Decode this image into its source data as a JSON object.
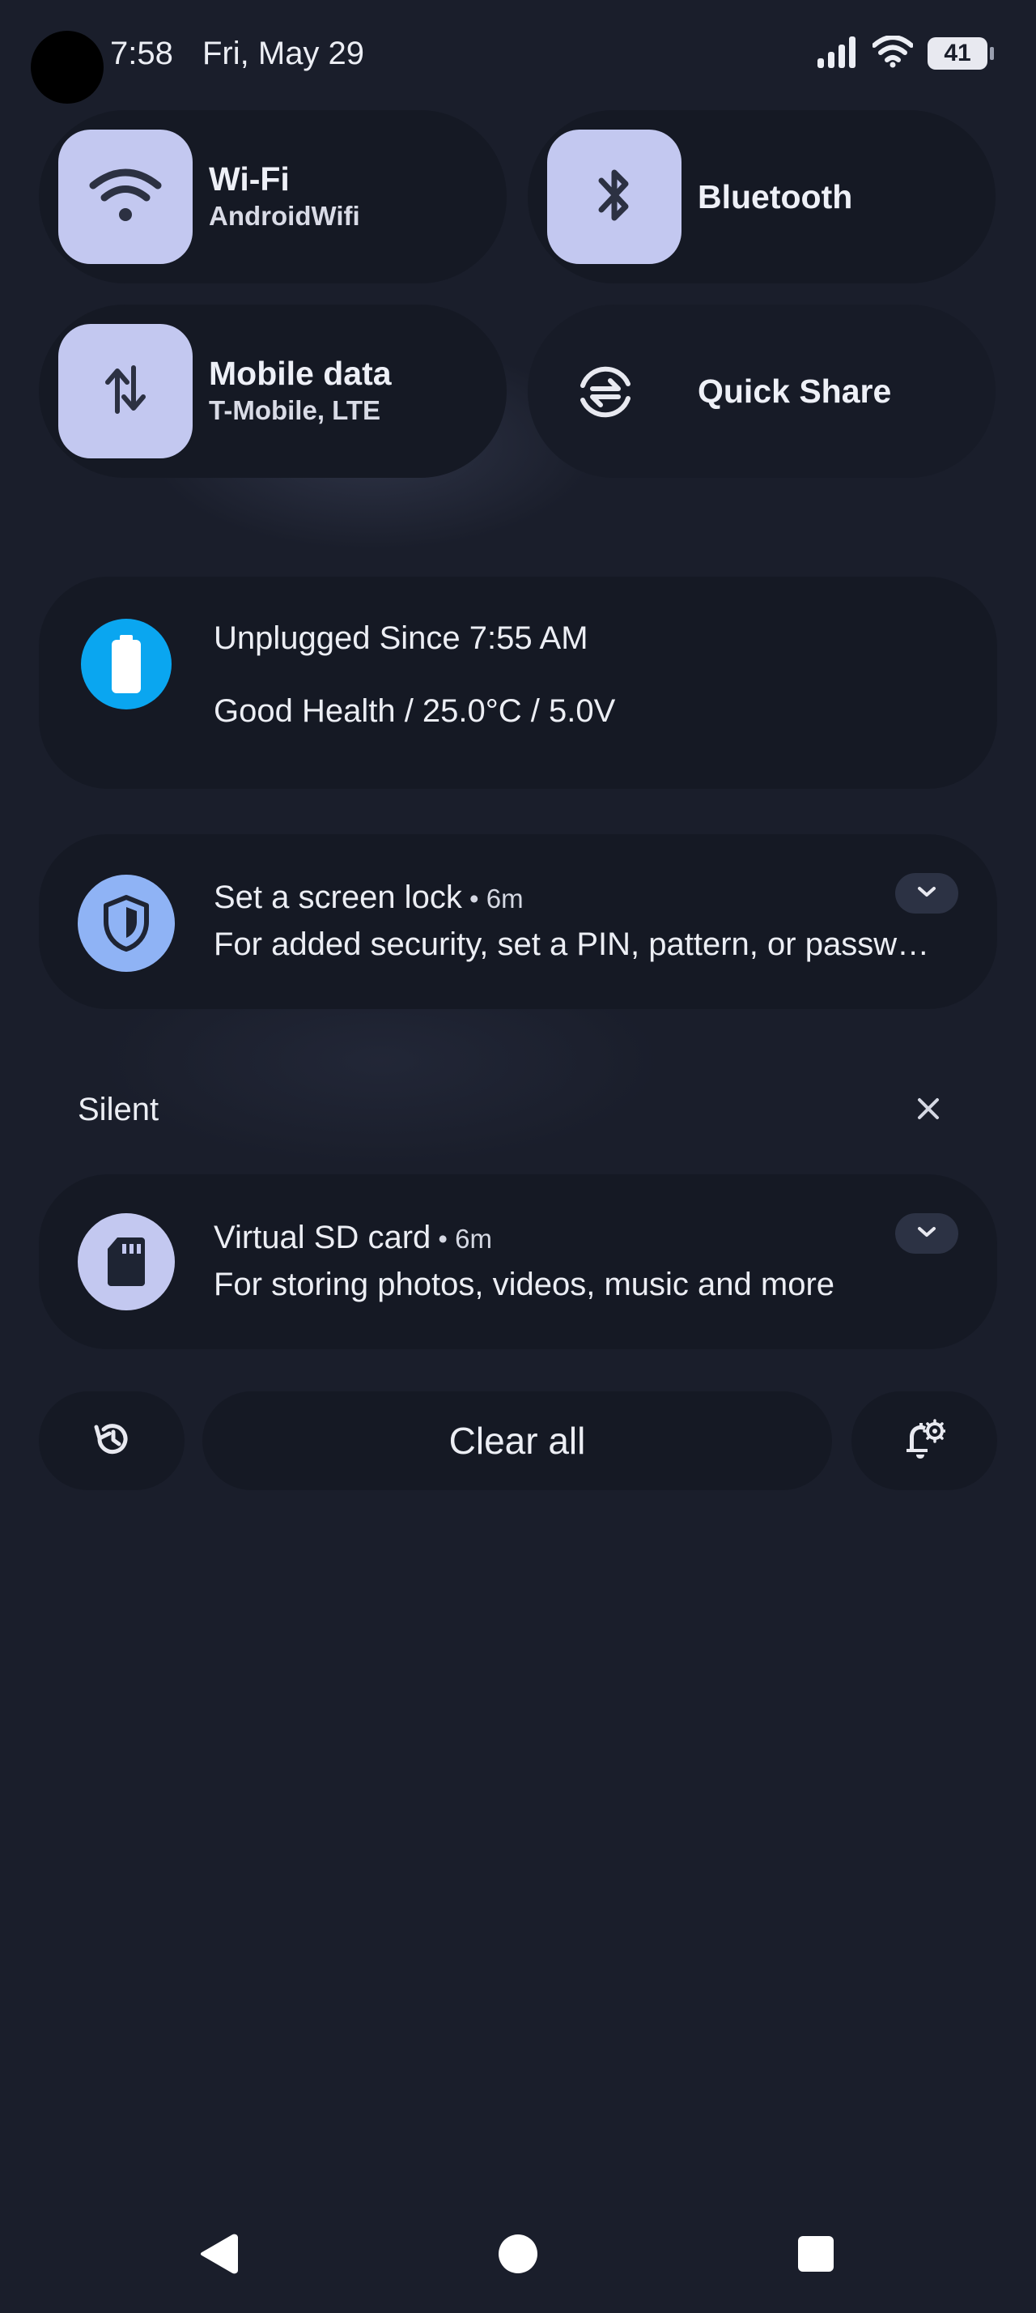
{
  "status_bar": {
    "time": "7:58",
    "date": "Fri, May 29",
    "battery_level": "41"
  },
  "quick_settings": {
    "wifi": {
      "title": "Wi-Fi",
      "subtitle": "AndroidWifi"
    },
    "bluetooth": {
      "title": "Bluetooth"
    },
    "mobile_data": {
      "title": "Mobile data",
      "subtitle": "T-Mobile, LTE"
    },
    "quick_share": {
      "title": "Quick Share"
    }
  },
  "battery_card": {
    "line1": "Unplugged Since 7:55 AM",
    "line2": "Good Health / 25.0°C / 5.0V"
  },
  "notifications": [
    {
      "title": "Set a screen lock",
      "time": "6m",
      "text": "For added security, set a PIN, pattern, or passw…"
    }
  ],
  "silent_section": {
    "label": "Silent",
    "notifications": [
      {
        "title": "Virtual SD card",
        "time": "6m",
        "text": "For storing photos, videos, music and more"
      }
    ]
  },
  "actions": {
    "clear_all_label": "Clear all"
  },
  "icons": {
    "wifi": "wifi-icon",
    "bluetooth": "bluetooth-icon",
    "mobile_data": "mobile-data-icon",
    "quick_share": "quick-share-icon",
    "battery": "battery-icon",
    "shield": "shield-icon",
    "sd_card": "sd-card-icon",
    "history": "history-icon",
    "notification_settings": "notification-settings-icon"
  },
  "colors": {
    "background": "#1a1e2b",
    "card": "#151924",
    "tile_active": "#c3c8f0",
    "battery_accent": "#0aa6f0",
    "shield_accent": "#8fb3f5"
  }
}
